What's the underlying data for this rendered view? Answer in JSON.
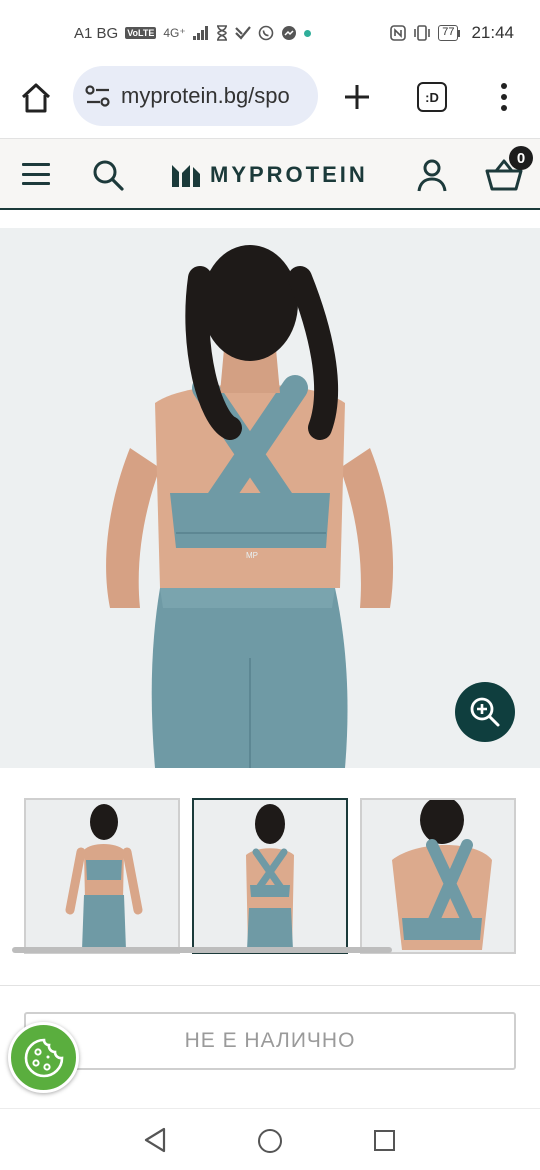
{
  "status_bar": {
    "carrier": "A1 BG",
    "volte": "VoLTE",
    "network": "4G⁺",
    "battery": "77",
    "time": "21:44"
  },
  "browser": {
    "url": "myprotein.bg/spo",
    "tabs_label": ":D"
  },
  "header": {
    "logo_text": "MYPROTEIN",
    "basket_count": "0"
  },
  "product": {
    "thumbnail_count": 3,
    "active_thumbnail": 2
  },
  "actions": {
    "out_of_stock_label": "НЕ Е НАЛИЧНО"
  },
  "colors": {
    "brand_dark": "#1b3a3a",
    "zoom_button": "#0f3e3e",
    "cookie_button": "#5aae3e",
    "product_color": "#6f9ba6"
  }
}
